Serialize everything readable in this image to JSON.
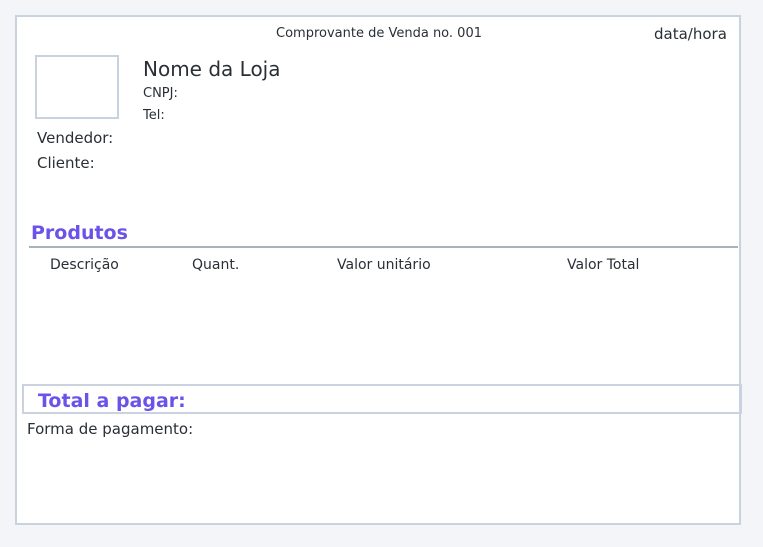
{
  "header": {
    "title": "Comprovante de Venda no. 001",
    "datetime": "data/hora"
  },
  "store": {
    "name": "Nome da Loja",
    "cnpj_label": "CNPJ:",
    "tel_label": "Tel:"
  },
  "parties": {
    "seller_label": "Vendedor:",
    "client_label": "Cliente:"
  },
  "products": {
    "section_title": "Produtos",
    "columns": [
      "Descrição",
      "Quant.",
      "Valor unitário",
      "Valor Total"
    ]
  },
  "total": {
    "label": "Total  a pagar:"
  },
  "payment": {
    "label": "Forma de pagamento:"
  },
  "colors": {
    "accent": "#6b52e8",
    "border": "#c9d3df",
    "divider": "#a9b1bb",
    "background": "#f3f5f8"
  }
}
